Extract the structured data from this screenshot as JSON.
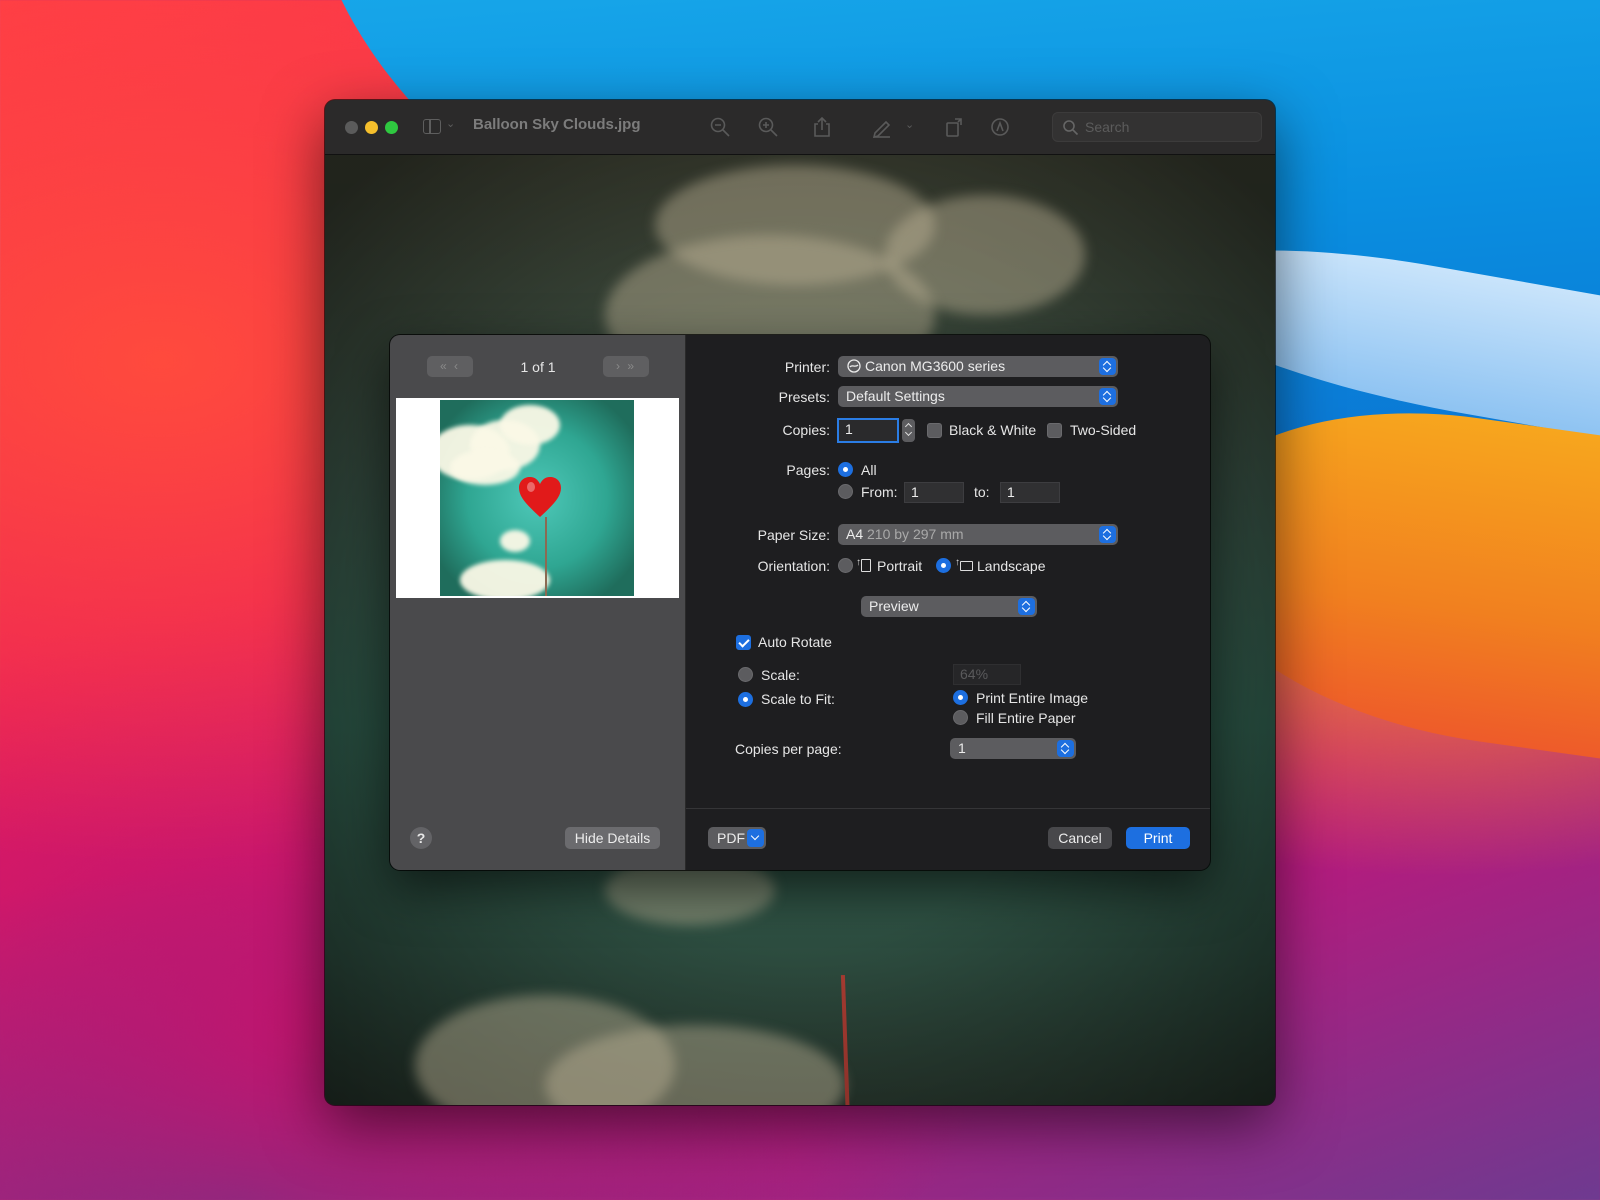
{
  "window": {
    "title": "Balloon Sky Clouds.jpg",
    "search_placeholder": "Search",
    "toolbar_icons": [
      "zoom-out-icon",
      "zoom-in-icon",
      "share-icon",
      "markup-pen-icon",
      "rotate-icon",
      "annotate-icon"
    ]
  },
  "print_dialog": {
    "preview": {
      "page_count": "1 of 1",
      "hide_details_label": "Hide Details",
      "help_label": "?"
    },
    "printer": {
      "label": "Printer:",
      "value": "Canon MG3600 series"
    },
    "presets": {
      "label": "Presets:",
      "value": "Default Settings"
    },
    "copies": {
      "label": "Copies:",
      "value": "1"
    },
    "black_white": {
      "label": "Black & White",
      "checked": false
    },
    "two_sided": {
      "label": "Two-Sided",
      "checked": false
    },
    "pages": {
      "label": "Pages:",
      "all_label": "All",
      "from_label": "From:",
      "from_value": "1",
      "to_label": "to:",
      "to_value": "1",
      "selected": "All"
    },
    "paper_size": {
      "label": "Paper Size:",
      "name": "A4",
      "detail": "210 by 297 mm"
    },
    "orientation": {
      "label": "Orientation:",
      "portrait_label": "Portrait",
      "landscape_label": "Landscape",
      "selected": "Landscape"
    },
    "section_popup": "Preview",
    "auto_rotate": {
      "label": "Auto Rotate",
      "checked": true
    },
    "scale": {
      "label": "Scale:",
      "value": "64%"
    },
    "scale_to_fit": {
      "label": "Scale to Fit:",
      "print_entire_label": "Print Entire Image",
      "fill_entire_label": "Fill Entire Paper",
      "selected": "Print Entire Image"
    },
    "copies_per_page": {
      "label": "Copies per page:",
      "value": "1"
    },
    "buttons": {
      "pdf": "PDF",
      "cancel": "Cancel",
      "print": "Print"
    }
  },
  "colors": {
    "accent": "#1d6fe0",
    "dialog_bg": "#1e1e20",
    "preview_bg": "#4a4a4c"
  }
}
